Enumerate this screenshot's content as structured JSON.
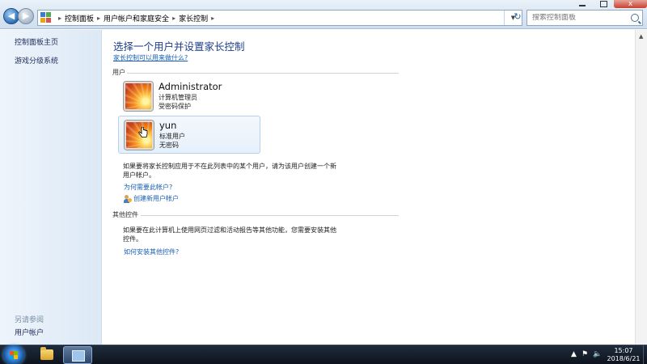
{
  "address_bar": {
    "breadcrumbs": [
      "控制面板",
      "用户帐户和家庭安全",
      "家长控制"
    ],
    "search_placeholder": "搜索控制面板"
  },
  "window_controls": {
    "close_label": "x"
  },
  "left_nav": {
    "links": [
      "控制面板主页",
      "游戏分级系统"
    ],
    "see_also_label": "另请参阅",
    "see_also_links": [
      "用户帐户"
    ]
  },
  "main": {
    "heading": "选择一个用户并设置家长控制",
    "help_link": "家长控制可以用来做什么?",
    "users_section_label": "用户",
    "users": [
      {
        "name": "Administrator",
        "role": "计算机管理员",
        "password_status": "受密码保护"
      },
      {
        "name": "yun",
        "role": "标准用户",
        "password_status": "无密码"
      }
    ],
    "apply_note": "如果要将家长控制应用于不在此列表中的某个用户，请为该用户创建一个新用户帐户。",
    "why_account_link": "为何需要此帐户?",
    "create_account_link": "创建新用户帐户",
    "other_controls_label": "其他控件",
    "other_controls_note": "如果要在此计算机上使用网页过滤和活动报告等其他功能，您需要安装其他控件。",
    "install_controls_link": "如何安装其他控件?"
  },
  "taskbar": {
    "time": "15:07",
    "date": "2018/6/21"
  }
}
